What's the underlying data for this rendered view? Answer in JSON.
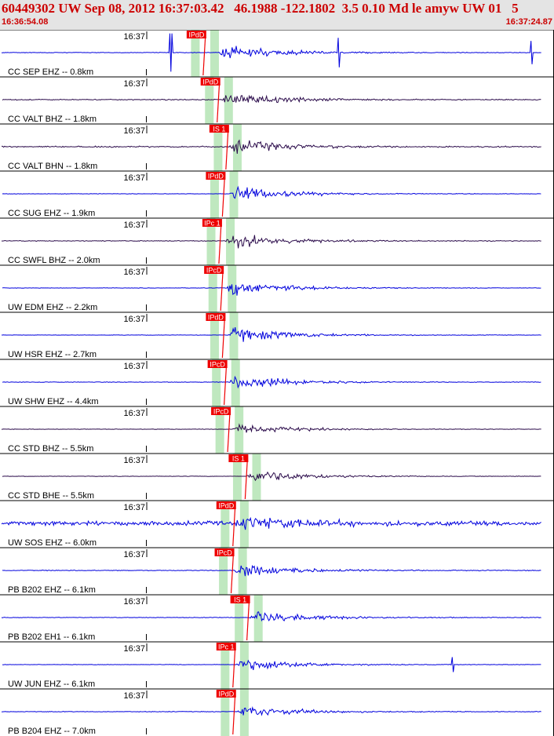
{
  "header": {
    "title": "60449302 UW Sep 08, 2012 16:37:03.42   46.1988 -122.1802  3.5 0.10 Md le amyw UW 01   5",
    "start_time": "16:36:54.08",
    "end_time": "16:37:24.87"
  },
  "colors": {
    "header_text": "#cc0000",
    "header_bg": "#e4e4e4",
    "blue_trace": "#0000dd",
    "purple_trace": "#2a0a4a",
    "pick_flag": "#ee0000",
    "window_band": "#bfe8bf"
  },
  "chart_data": {
    "type": "line",
    "title": "60449302 UW Sep 08, 2012 16:37:03.42   46.1988 -122.1802  3.5 0.10 Md le amyw UW 01   5",
    "x_range": [
      "16:36:54.08",
      "16:37:24.87"
    ],
    "x_tick_label": "16:37",
    "grid": false,
    "traces": [
      {
        "label": "CC SEP EHZ -- 0.8km",
        "pick": "IPdD",
        "color": "blue",
        "pick_time_s": 8.2,
        "onset_s": 10.0,
        "amp": 0.9,
        "noise": 0.03,
        "spikes": [
          [
            7.3,
            0.9
          ],
          [
            16.9,
            0.7
          ],
          [
            27.9,
            0.55
          ]
        ]
      },
      {
        "label": "CC VALT BHZ -- 1.8km",
        "pick": "IPdD",
        "color": "purple",
        "pick_time_s": 9.0,
        "onset_s": 10.2,
        "amp": 0.75,
        "noise": 0.05
      },
      {
        "label": "CC VALT BHN -- 1.8km",
        "pick": "IS 1",
        "color": "purple",
        "pick_time_s": 9.5,
        "onset_s": 10.6,
        "amp": 0.75,
        "noise": 0.06
      },
      {
        "label": "CC SUG EHZ -- 1.9km",
        "pick": "IPdD",
        "color": "blue",
        "pick_time_s": 9.3,
        "onset_s": 10.6,
        "amp": 0.85,
        "noise": 0.02
      },
      {
        "label": "CC SWFL BHZ -- 2.0km",
        "pick": "IPc 1",
        "color": "purple",
        "pick_time_s": 9.1,
        "onset_s": 10.4,
        "amp": 0.8,
        "noise": 0.04
      },
      {
        "label": "UW EDM EHZ -- 2.2km",
        "pick": "IPcD",
        "color": "blue",
        "pick_time_s": 9.2,
        "onset_s": 10.4,
        "amp": 0.85,
        "noise": 0.02
      },
      {
        "label": "UW HSR EHZ -- 2.7km",
        "pick": "IPdD",
        "color": "blue",
        "pick_time_s": 9.3,
        "onset_s": 10.6,
        "amp": 0.85,
        "noise": 0.02
      },
      {
        "label": "UW SHW EHZ -- 4.4km",
        "pick": "IPcD",
        "color": "blue",
        "pick_time_s": 9.4,
        "onset_s": 10.6,
        "amp": 0.8,
        "noise": 0.03
      },
      {
        "label": "CC STD BHZ -- 5.5km",
        "pick": "IPcD",
        "color": "purple",
        "pick_time_s": 9.6,
        "onset_s": 10.8,
        "amp": 0.6,
        "noise": 0.02
      },
      {
        "label": "CC STD BHE -- 5.5km",
        "pick": "IS 1",
        "color": "purple",
        "pick_time_s": 10.6,
        "onset_s": 11.6,
        "amp": 0.75,
        "noise": 0.02
      },
      {
        "label": "UW SOS EHZ -- 6.0km",
        "pick": "IPdD",
        "color": "blue",
        "pick_time_s": 9.9,
        "onset_s": 10.9,
        "amp": 0.7,
        "noise": 0.22
      },
      {
        "label": "PB B202 EHZ -- 6.1km",
        "pick": "IPcD",
        "color": "blue",
        "pick_time_s": 9.8,
        "onset_s": 10.9,
        "amp": 0.7,
        "noise": 0.04
      },
      {
        "label": "PB B202 EH1 -- 6.1km",
        "pick": "IS 1",
        "color": "blue",
        "pick_time_s": 10.7,
        "onset_s": 11.8,
        "amp": 0.7,
        "noise": 0.03
      },
      {
        "label": "UW JUN EHZ -- 6.1km",
        "pick": "IPc 1",
        "color": "blue",
        "pick_time_s": 9.9,
        "onset_s": 11.0,
        "amp": 0.7,
        "noise": 0.02,
        "spikes": [
          [
            23.4,
            0.35
          ]
        ]
      },
      {
        "label": "PB B204 EHZ -- 7.0km",
        "pick": "IPdD",
        "color": "blue",
        "pick_time_s": 9.9,
        "onset_s": 11.1,
        "amp": 0.7,
        "noise": 0.03
      }
    ]
  }
}
